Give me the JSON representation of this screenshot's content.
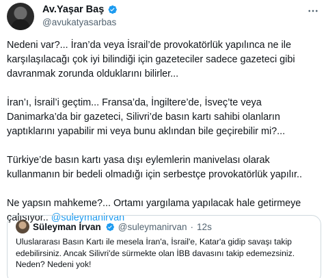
{
  "author": {
    "display_name": "Av.Yaşar Baş",
    "handle": "@avukatyasarbas"
  },
  "tweet": {
    "paragraphs": [
      "Nedeni var?... İran’da veya İsrail’de provokatörlük yapılınca ne ile karşılaşılacağı çok iyi bilindiği için gazeteciler sadece gazeteci gibi davranmak zorunda olduklarını bilirler...",
      "İran’ı, İsrail’i geçtim... Fransa’da, İngiltere’de, İsveç’te veya Danimarka’da bir gazeteci, Silivri’de basın kartı sahibi olanların yaptıklarını yapabilir mi veya bunu aklından bile geçirebilir mi?...",
      "Türkiye’de basın kartı yasa dışı eylemlerin manivelası olarak kullanmanın bir bedeli olmadığı için serbestçe provokatörlük yapılır.."
    ],
    "last_paragraph_text": "Ne yapsın mahkeme?... Ortamı yargılama yapılacak hale getirmeye çalışıyor.. ",
    "last_paragraph_mention": "@suleymanirvan"
  },
  "quoted_tweet": {
    "display_name": "Süleyman İrvan",
    "handle": "@suleymanirvan",
    "separator": "·",
    "time": "12s",
    "text": "Uluslararası Basın Kartı ile mesela İran'a, İsrail'e, Katar'a gidip savaşı takip edebilirsiniz. Ancak Silivri'de sürmekte olan İBB davasını takip edemezsiniz. Neden? Nedeni yok!"
  },
  "colors": {
    "accent": "#1d9bf0",
    "secondary_text": "#536471",
    "border": "#cfd9de"
  },
  "icons": {
    "verified": "verified-badge-icon",
    "more": "more-options-icon"
  }
}
